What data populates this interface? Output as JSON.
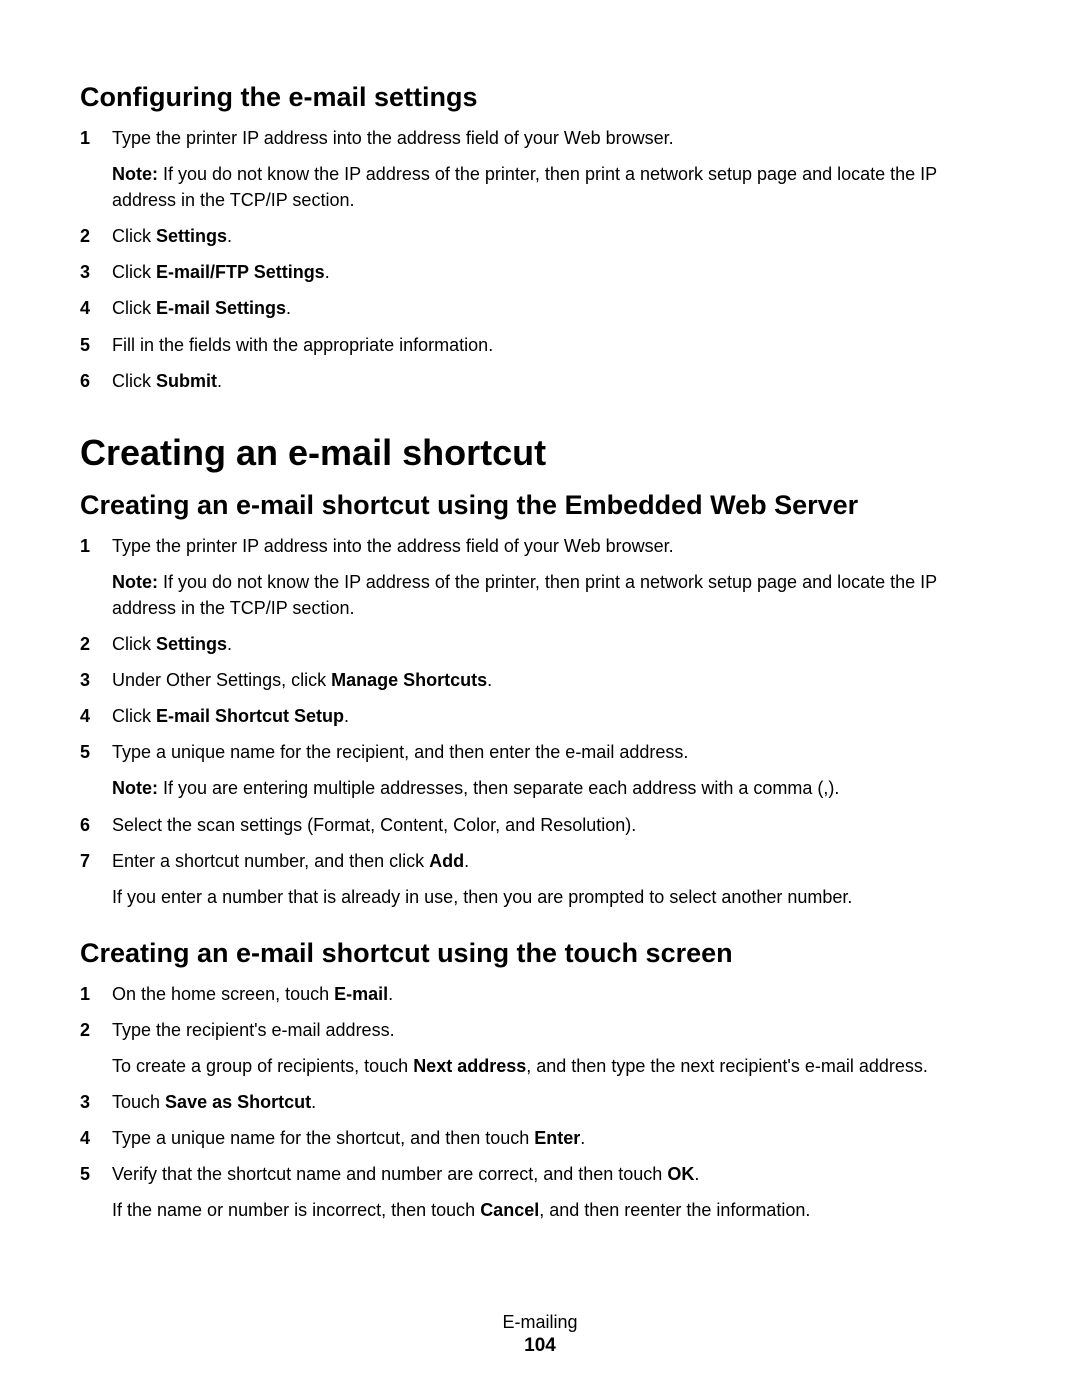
{
  "headings": {
    "h_conf": "Configuring the e-mail settings",
    "h_create_main": "Creating an e-mail shortcut",
    "h_create_web": "Creating an e-mail shortcut using the Embedded Web Server",
    "h_create_touch": "Creating an e-mail shortcut using the touch screen"
  },
  "labels": {
    "note": "Note:",
    "settings": "Settings",
    "email_ftp": "E-mail/FTP Settings",
    "email_settings": "E-mail Settings",
    "submit": "Submit",
    "manage_shortcuts": "Manage Shortcuts",
    "email_shortcut_setup": "E-mail Shortcut Setup",
    "add": "Add",
    "email": "E-mail",
    "next_address": "Next address",
    "save_shortcut": "Save as Shortcut",
    "enter": "Enter",
    "ok": "OK",
    "cancel": "Cancel",
    "click": "Click ",
    "touch": "Touch ",
    "under_other": "Under Other Settings, click ",
    "period": "."
  },
  "text": {
    "conf_s1": "Type the printer IP address into the address field of your Web browser.",
    "conf_s1_note": " If you do not know the IP address of the printer, then print a network setup page and locate the IP address in the TCP/IP section.",
    "conf_s5": "Fill in the fields with the appropriate information.",
    "web_s5": "Type a unique name for the recipient, and then enter the e-mail address.",
    "web_s5_note": " If you are entering multiple addresses, then separate each address with a comma (,).",
    "web_s6": "Select the scan settings (Format, Content, Color, and Resolution).",
    "web_s7a": "Enter a shortcut number, and then click ",
    "web_s7b": "If you enter a number that is already in use, then you are prompted to select another number.",
    "touch_s1a": "On the home screen, touch ",
    "touch_s2a": "Type the recipient's e-mail address.",
    "touch_s2b_pre": "To create a group of recipients, touch ",
    "touch_s2b_post": ", and then type the next recipient's e-mail address.",
    "touch_s4a": "Type a unique name for the shortcut, and then touch ",
    "touch_s5a": "Verify that the shortcut name and number are correct, and then touch ",
    "touch_s5b_pre": "If the name or number is incorrect, then touch ",
    "touch_s5b_post": ", and then reenter the information."
  },
  "nums": {
    "n1": "1",
    "n2": "2",
    "n3": "3",
    "n4": "4",
    "n5": "5",
    "n6": "6",
    "n7": "7"
  },
  "footer": {
    "title": "E-mailing",
    "page": "104"
  }
}
